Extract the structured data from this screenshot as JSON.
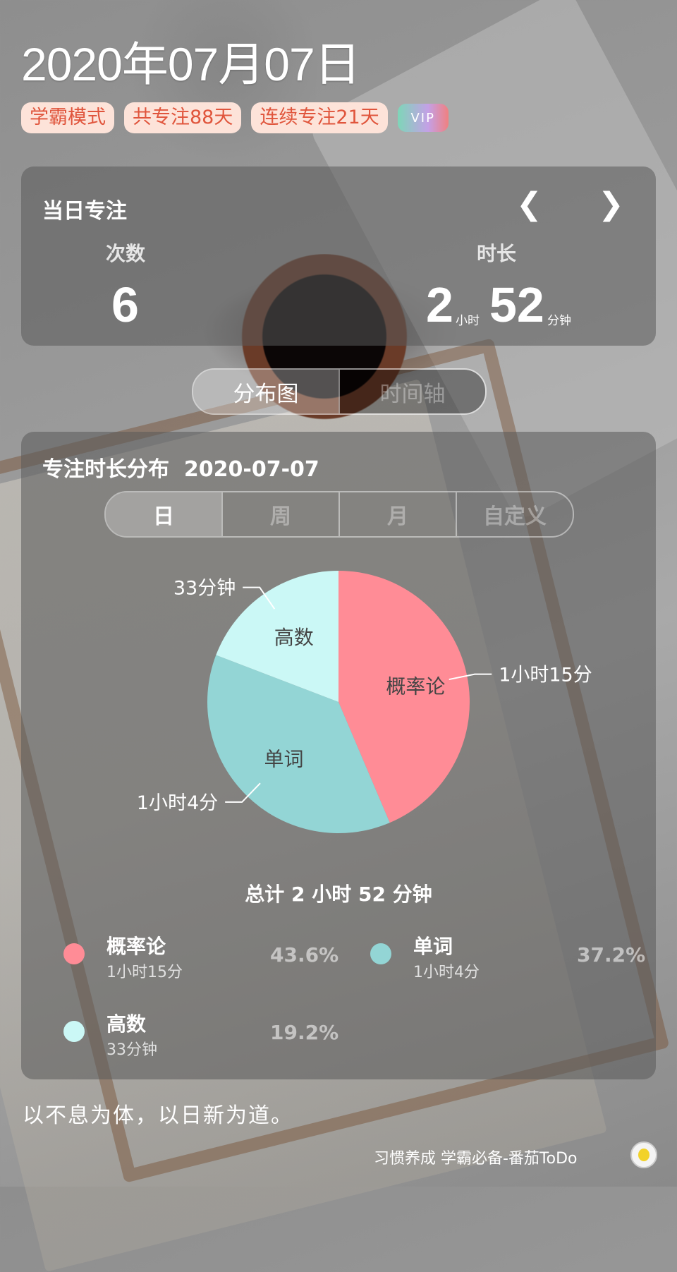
{
  "date": "2020年07月07日",
  "tags": [
    "学霸模式",
    "共专注88天",
    "连续专注21天"
  ],
  "vip": "VIP",
  "focus_card": {
    "title": "当日专注",
    "count_label": "次数",
    "count_value": "6",
    "duration_label": "时长",
    "hours_value": "2",
    "hours_unit": "小时",
    "minutes_value": "52",
    "minutes_unit": "分钟"
  },
  "view_tabs": [
    "分布图",
    "时间轴"
  ],
  "distribution": {
    "title": "专注时长分布",
    "date": "2020-07-07",
    "range_tabs": [
      "日",
      "周",
      "月",
      "自定义"
    ],
    "total": "总计 2 小时 52 分钟"
  },
  "chart_data": {
    "type": "pie",
    "slices": [
      {
        "label": "概率论",
        "value": 75,
        "value_text": "1小时15分",
        "percent": "43.6%",
        "color": "#ff8c96"
      },
      {
        "label": "单词",
        "value": 64,
        "value_text": "1小时4分",
        "percent": "37.2%",
        "color": "#93d5d5"
      },
      {
        "label": "高数",
        "value": 33,
        "value_text": "33分钟",
        "percent": "19.2%",
        "color": "#cbf8f6"
      }
    ]
  },
  "quote": "以不息为体，以日新为道。",
  "footer": "习惯养成 学霸必备-番茄ToDo"
}
